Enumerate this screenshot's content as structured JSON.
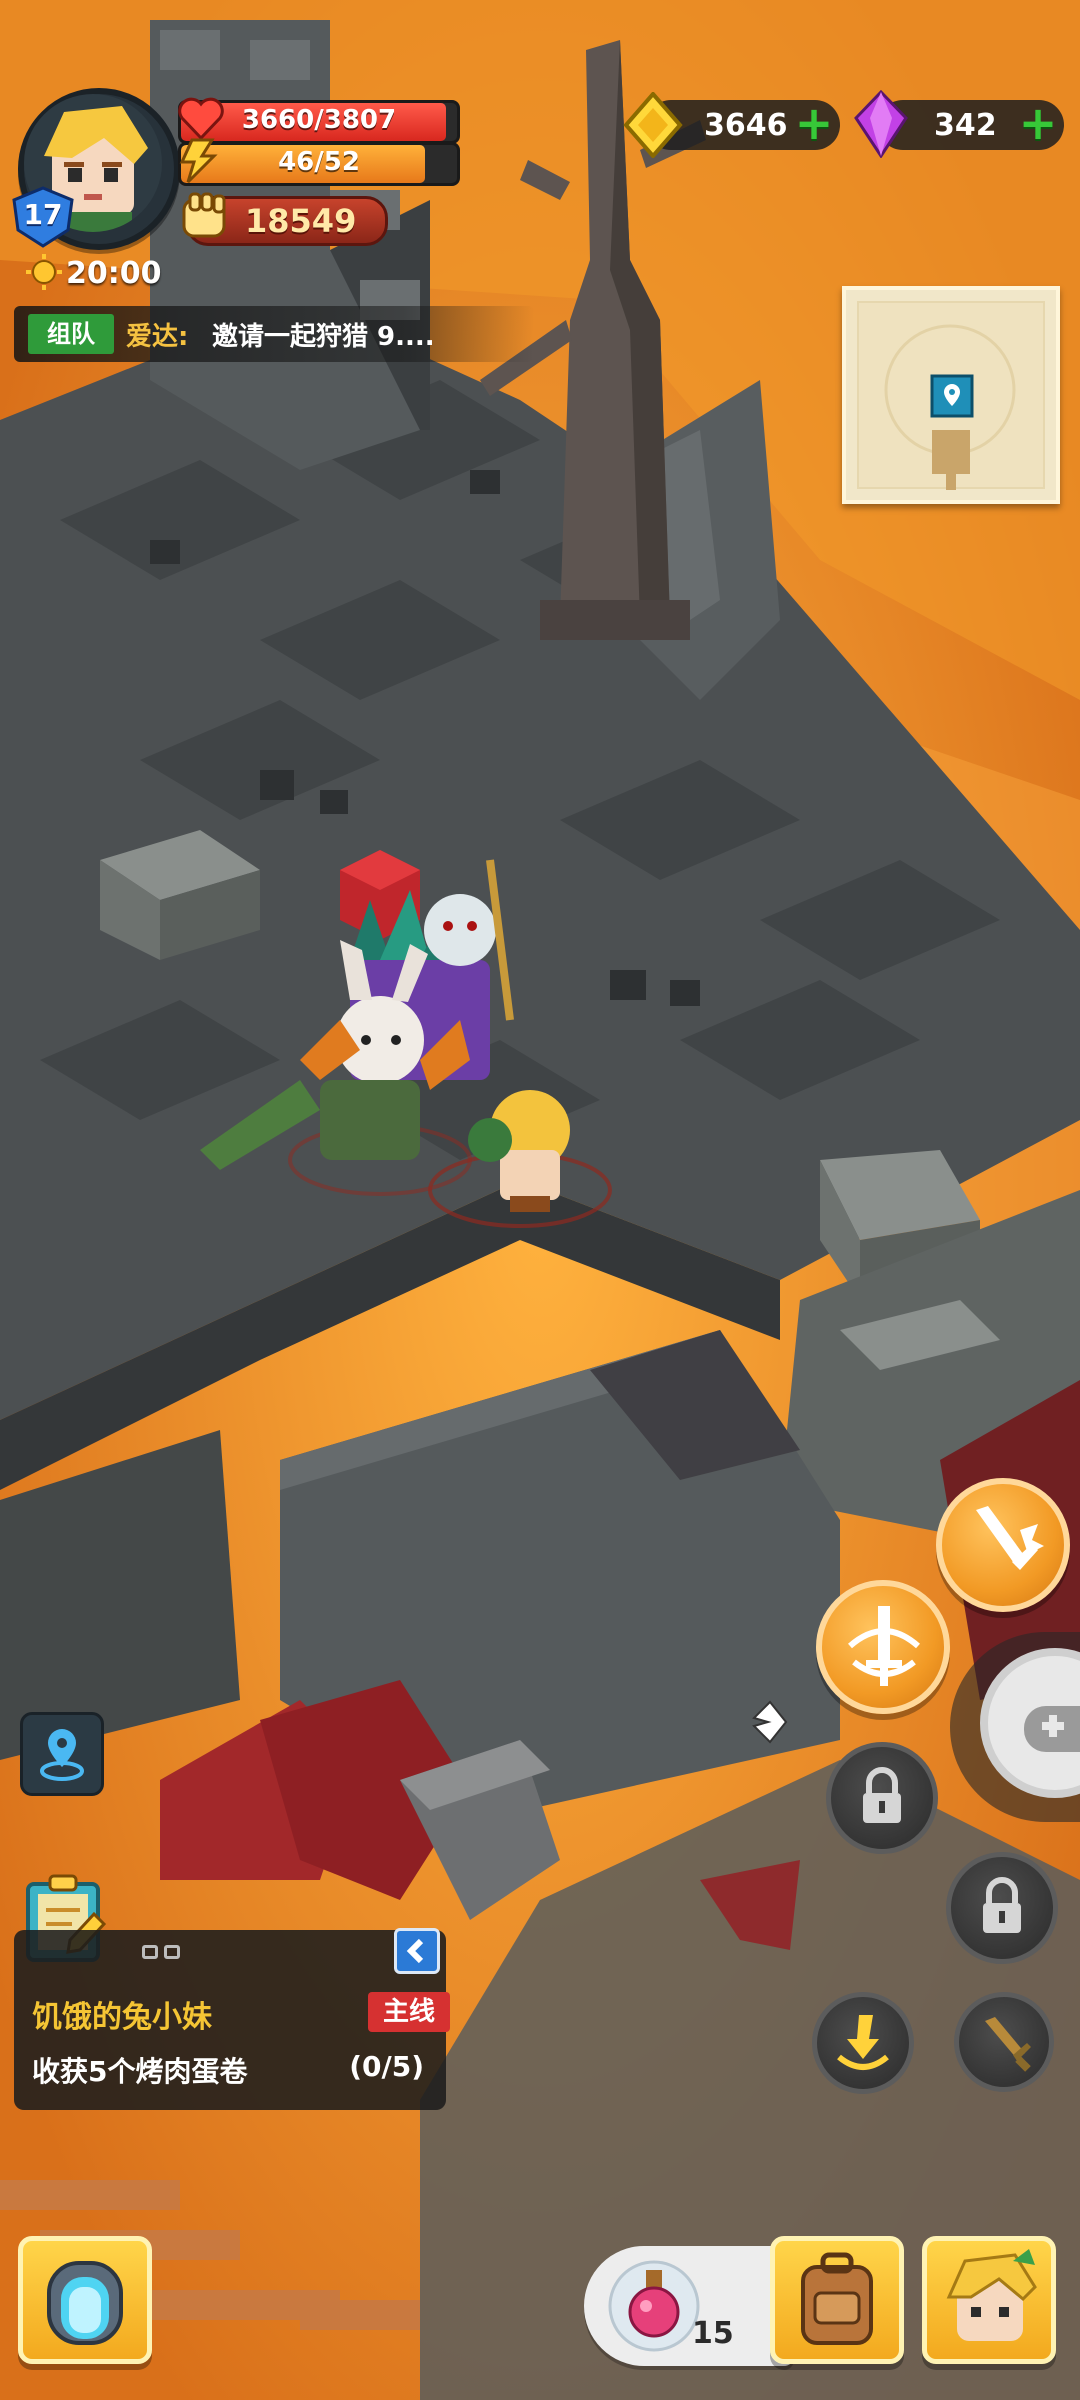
{
  "player": {
    "level": "17",
    "hp_text": "3660/3807",
    "hp_fraction": 0.961,
    "energy_text": "46/52",
    "energy_fraction": 0.885,
    "power": "18549",
    "time": "20:00"
  },
  "chat": {
    "channel": "组队",
    "sender": "爱达:",
    "message": "邀请一起狩猎 9...."
  },
  "currency": {
    "gold": "3646",
    "gems": "342"
  },
  "quest": {
    "title": "饥饿的兔小妹",
    "tag": "主线",
    "description": "收获5个烤肉蛋卷",
    "progress": "(0/5)"
  },
  "inventory": {
    "potion_count": "15"
  },
  "colors": {
    "hp": "#e8372f",
    "energy": "#f08c1c",
    "lava": "#e8871f",
    "stone": "#4f5355",
    "skill_orange": "#f29a25",
    "quest_title": "#f5c534",
    "plus_green": "#37c838"
  },
  "icons": {
    "heart": "heart-icon",
    "lightning": "lightning-icon",
    "power": "fist-icon",
    "sun": "sun-icon",
    "gold": "gold-diamond-icon",
    "gem": "purple-gem-icon",
    "location": "location-pin-icon",
    "map": "map-scroll-icon"
  }
}
